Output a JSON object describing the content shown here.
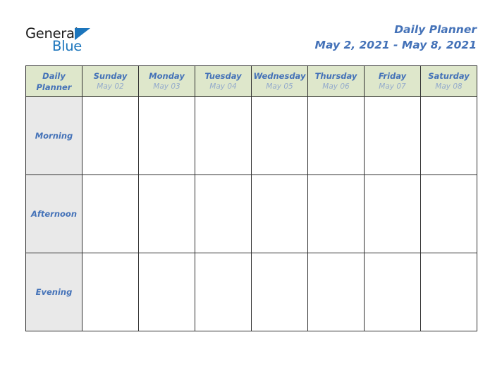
{
  "brand": {
    "name_dark": "General",
    "name_blue": "Blue",
    "dark_color": "#1c1c1c",
    "blue_color": "#1b75bc"
  },
  "title": {
    "heading": "Daily Planner",
    "date_range": "May 2, 2021 - May 8, 2021",
    "color": "#4472b8"
  },
  "table": {
    "corner": {
      "line1": "Daily",
      "line2": "Planner"
    },
    "header_bg": "#dee7cb",
    "label_bg": "#e9e9e9",
    "border_color": "#2f2f2f",
    "columns": [
      {
        "day": "Sunday",
        "date": "May 02"
      },
      {
        "day": "Monday",
        "date": "May 03"
      },
      {
        "day": "Tuesday",
        "date": "May 04"
      },
      {
        "day": "Wednesday",
        "date": "May 05"
      },
      {
        "day": "Thursday",
        "date": "May 06"
      },
      {
        "day": "Friday",
        "date": "May 07"
      },
      {
        "day": "Saturday",
        "date": "May 08"
      }
    ],
    "rows": [
      {
        "label": "Morning",
        "cells": [
          "",
          "",
          "",
          "",
          "",
          "",
          ""
        ]
      },
      {
        "label": "Afternoon",
        "cells": [
          "",
          "",
          "",
          "",
          "",
          "",
          ""
        ]
      },
      {
        "label": "Evening",
        "cells": [
          "",
          "",
          "",
          "",
          "",
          "",
          ""
        ]
      }
    ]
  }
}
